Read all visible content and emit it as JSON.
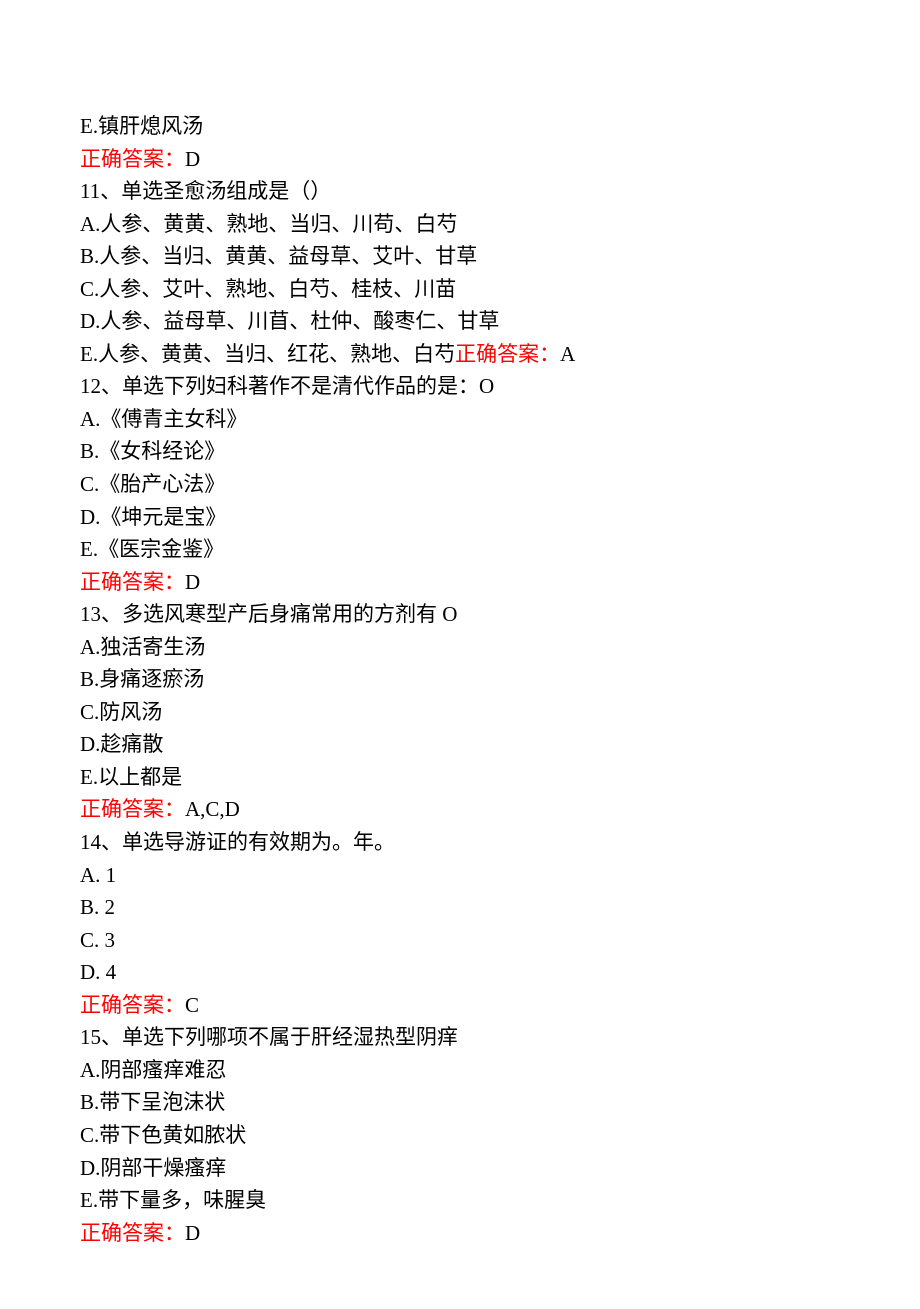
{
  "q10": {
    "optE": "E.镇肝熄风汤",
    "ansLabel": "正确答案：",
    "ansVal": "D"
  },
  "q11": {
    "stem": "11、单选圣愈汤组成是（）",
    "A": "A.人参、黄黄、熟地、当归、川苟、白芍",
    "B": "B.人参、当归、黄黄、益母草、艾叶、甘草",
    "C": "C.人参、艾叶、熟地、白芍、桂枝、川苗",
    "D": "D.人参、益母草、川苜、杜仲、酸枣仁、甘草",
    "E": "E.人参、黄黄、当归、红花、熟地、白芍",
    "ansLabel": "正确答案：",
    "ansVal": "A"
  },
  "q12": {
    "stem": "12、单选下列妇科著作不是清代作品的是：O",
    "A": "A.《傅青主女科》",
    "B": "B.《女科经论》",
    "C": "C.《胎产心法》",
    "D": "D.《坤元是宝》",
    "E": "E.《医宗金鉴》",
    "ansLabel": "正确答案：",
    "ansVal": "D"
  },
  "q13": {
    "stem": "13、多选风寒型产后身痛常用的方剂有 O",
    "A": "A.独活寄生汤",
    "B": "B.身痛逐瘀汤",
    "C": "C.防风汤",
    "D": "D.趁痛散",
    "E": "E.以上都是",
    "ansLabel": "正确答案：",
    "ansVal": "A,C,D"
  },
  "q14": {
    "stem": "14、单选导游证的有效期为。年。",
    "A": "A. 1",
    "B": "B. 2",
    "C": "C. 3",
    "D": "D. 4",
    "ansLabel": "正确答案：",
    "ansVal": "C"
  },
  "q15": {
    "stem": "15、单选下列哪项不属于肝经湿热型阴痒",
    "A": "A.阴部瘙痒难忍",
    "B": "B.带下呈泡沫状",
    "C": "C.带下色黄如脓状",
    "D": "D.阴部干燥瘙痒",
    "E": "E.带下量多，味腥臭",
    "ansLabel": "正确答案：",
    "ansVal": "D"
  }
}
